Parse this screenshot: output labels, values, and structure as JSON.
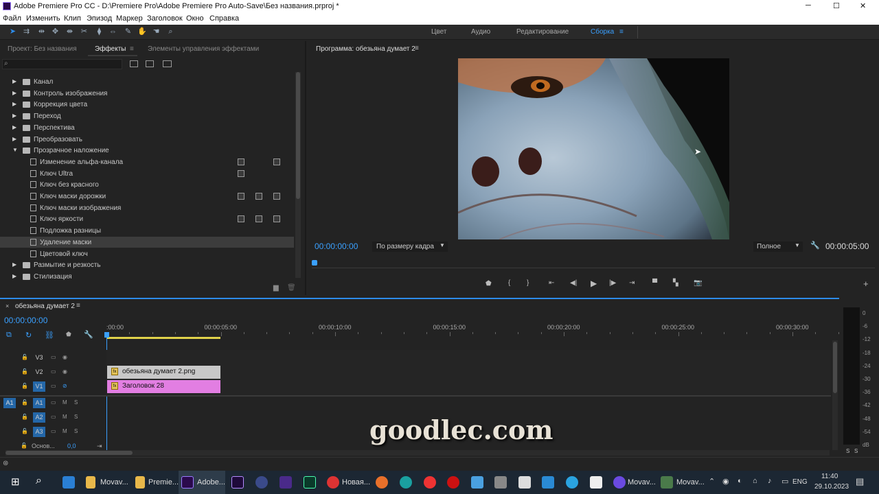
{
  "window": {
    "title": "Adobe Premiere Pro CC - D:\\Premiere Pro\\Adobe Premiere Pro Auto-Save\\Без названия.prproj *",
    "minimize": "─",
    "maximize": "☐",
    "close": "✕"
  },
  "menu": [
    "Файл",
    "Изменить",
    "Клип",
    "Эпизод",
    "Маркер",
    "Заголовок",
    "Окно",
    "Справка"
  ],
  "workspaces": [
    "Цвет",
    "Аудио",
    "Редактирование",
    "Сборка"
  ],
  "workspace_active": "Сборка",
  "left_panel": {
    "tabs": [
      "Проект: Без названия",
      "Эффекты",
      "Элементы управления эффектами"
    ],
    "active_tab": "Эффекты",
    "tree": [
      {
        "label": "Канал",
        "type": "folder",
        "expanded": false
      },
      {
        "label": "Контроль изображения",
        "type": "folder",
        "expanded": false
      },
      {
        "label": "Коррекция цвета",
        "type": "folder",
        "expanded": false
      },
      {
        "label": "Переход",
        "type": "folder",
        "expanded": false
      },
      {
        "label": "Перспектива",
        "type": "folder",
        "expanded": false
      },
      {
        "label": "Преобразовать",
        "type": "folder",
        "expanded": false
      },
      {
        "label": "Прозрачное наложение",
        "type": "folder",
        "expanded": true
      },
      {
        "label": "Изменение альфа-канала",
        "type": "effect",
        "badges": [
          1,
          0,
          1
        ]
      },
      {
        "label": "Ключ Ultra",
        "type": "effect",
        "badges": [
          1,
          0,
          0
        ]
      },
      {
        "label": "Ключ без красного",
        "type": "effect",
        "badges": [
          0,
          0,
          0
        ]
      },
      {
        "label": "Ключ маски дорожки",
        "type": "effect",
        "badges": [
          1,
          1,
          1
        ]
      },
      {
        "label": "Ключ маски изображения",
        "type": "effect",
        "badges": [
          0,
          0,
          0
        ]
      },
      {
        "label": "Ключ яркости",
        "type": "effect",
        "badges": [
          1,
          1,
          1
        ]
      },
      {
        "label": "Подложка разницы",
        "type": "effect",
        "badges": [
          0,
          0,
          0
        ]
      },
      {
        "label": "Удаление маски",
        "type": "effect",
        "badges": [
          0,
          0,
          0
        ],
        "selected": true
      },
      {
        "label": "Цветовой ключ",
        "type": "effect",
        "badges": [
          0,
          0,
          0
        ]
      },
      {
        "label": "Размытие и резкость",
        "type": "folder",
        "expanded": false
      },
      {
        "label": "Стилизация",
        "type": "folder",
        "expanded": false
      }
    ]
  },
  "program": {
    "title": "Программа: обезьяна думает 2",
    "timecode": "00:00:00:00",
    "zoom": "По размеру кадра",
    "quality": "Полное",
    "duration": "00:00:05:00"
  },
  "timeline": {
    "sequence_name": "обезьяна думает 2",
    "timecode": "00:00:00:00",
    "ruler": [
      ":00:00",
      "00:00:05:00",
      "00:00:10:00",
      "00:00:15:00",
      "00:00:20:00",
      "00:00:25:00",
      "00:00:30:00"
    ],
    "video_tracks": [
      "V3",
      "V2",
      "V1"
    ],
    "audio_tracks": [
      "A1",
      "A2",
      "A3"
    ],
    "source_patch": "A1",
    "clips": [
      {
        "label": "обезьяна думает 2.png",
        "track": "V2"
      },
      {
        "label": "Заголовок 28",
        "track": "V1"
      }
    ],
    "master_label": "Основ...",
    "master_value": "0,0",
    "m_label": "M",
    "s_label": "S"
  },
  "meter": {
    "scale": [
      "0",
      "-6",
      "-12",
      "-18",
      "-24",
      "-30",
      "-36",
      "-42",
      "-48",
      "-54",
      "dB"
    ],
    "solo_labels": [
      "S",
      "S"
    ]
  },
  "watermark": "goodlec.com",
  "taskbar": {
    "items": [
      "Movav...",
      "Premie...",
      "Adobe...",
      "Новая...",
      "Movav...",
      "Movav..."
    ],
    "lang": "ENG",
    "time": "11:40",
    "date": "29.10.2023"
  },
  "colors": {
    "accent": "#2d8ceb",
    "timecode": "#3aa0ff",
    "clip_v2": "#c8c8c8",
    "clip_v1": "#e27ee2",
    "work_area": "#e0d24a"
  }
}
